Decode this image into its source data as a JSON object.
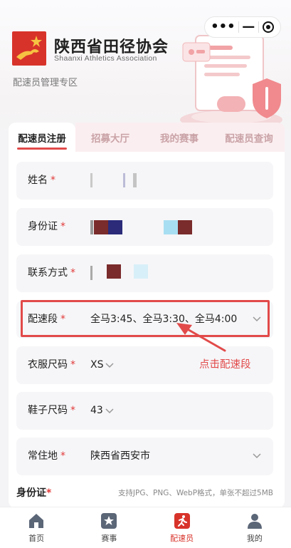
{
  "header": {
    "org_name": "陕西省田径协会",
    "org_name_en": "Shaanxi Athletics Association",
    "zone_label": "配速员管理专区",
    "capsule": {
      "more": "•••",
      "minimize": "—"
    }
  },
  "tabs": [
    {
      "label": "配速员注册",
      "active": true
    },
    {
      "label": "招募大厅",
      "active": false
    },
    {
      "label": "我的赛事",
      "active": false
    },
    {
      "label": "配速员查询",
      "active": false
    }
  ],
  "form": {
    "required_mark": "*",
    "name": {
      "label": "姓名"
    },
    "id_card": {
      "label": "身份证"
    },
    "phone": {
      "label": "联系方式"
    },
    "pace": {
      "label": "配速段",
      "value": "全马3:45、全马3:30、全马4:00"
    },
    "clothing": {
      "label": "衣服尺码",
      "value": "XS"
    },
    "shoe": {
      "label": "鞋子尺码",
      "value": "43"
    },
    "residence": {
      "label": "常住地",
      "value": "陕西省西安市"
    },
    "upload": {
      "title": "身份证",
      "hint": "支持JPG、PNG、WebP格式，单张不超过5MB"
    }
  },
  "annotation": {
    "label": "点击配速段",
    "color": "#e24a4a"
  },
  "bottom_nav": [
    {
      "label": "首页",
      "icon": "home-icon",
      "active": false
    },
    {
      "label": "赛事",
      "icon": "star-icon",
      "active": false
    },
    {
      "label": "配速员",
      "icon": "runner-icon",
      "active": true
    },
    {
      "label": "我的",
      "icon": "person-icon",
      "active": false
    }
  ],
  "colors": {
    "accent": "#d8332a",
    "tab_bg": "#fbeef0",
    "row_bg": "#f6f6f8"
  }
}
